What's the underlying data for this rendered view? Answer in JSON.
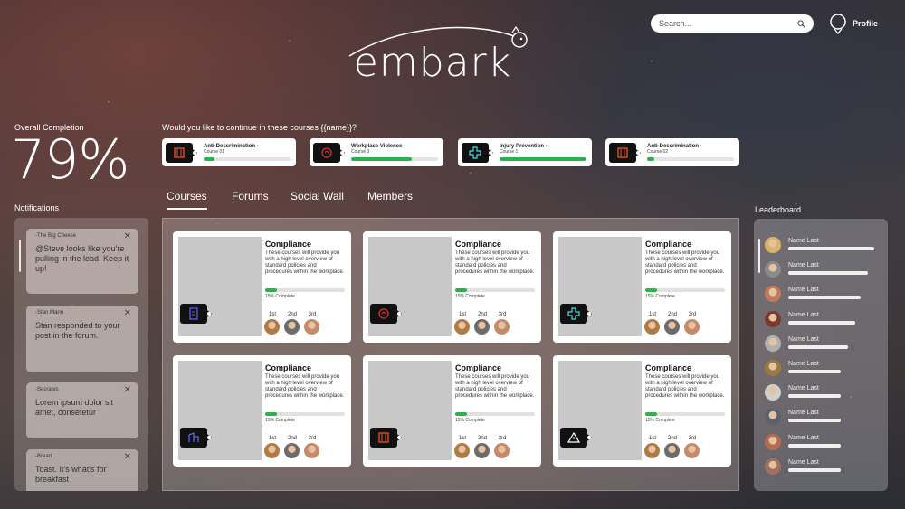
{
  "brand": {
    "name": "embark"
  },
  "search": {
    "placeholder": "Search..."
  },
  "profile": {
    "label": "Profile"
  },
  "overall": {
    "label": "Overall Completion",
    "value": "79%"
  },
  "continue": {
    "label": "Would you like to continue in these courses {{name}}?",
    "items": [
      {
        "title": "Anti-Descrimination -",
        "sub": "Course 01",
        "progress": 0.12,
        "icon": "shield-icon"
      },
      {
        "title": "Workplace Violence -",
        "sub": "Course 3",
        "progress": 0.7,
        "icon": "alarm-icon"
      },
      {
        "title": "Injury Prevention -",
        "sub": "Course 1",
        "progress": 1.0,
        "icon": "medical-cross-icon"
      },
      {
        "title": "Anti-Descrimination -",
        "sub": "Course 02",
        "progress": 0.08,
        "icon": "shield-icon"
      }
    ]
  },
  "notifications": {
    "label": "Notifications",
    "items": [
      {
        "author": "-The Big Cheese",
        "text": "@Steve looks like you're pulling in the lead. Keep it up!"
      },
      {
        "author": "-Stan Mann",
        "text": "Stan responded to your post in the forum."
      },
      {
        "author": "-Socrates",
        "text": "Lorem ipsum dolor sit amet, consetetur"
      },
      {
        "author": "-Bread",
        "text": "Toast. It's what's for breakfast"
      }
    ]
  },
  "tabs": [
    "Courses",
    "Forums",
    "Social Wall",
    "Members"
  ],
  "courses": [
    {
      "title": "Compliance",
      "desc": "These courses will provide you with a high level overview of standard policies and procedures within the workplace.",
      "pct_label": "15% Complete",
      "progress": 0.15,
      "icon": "document-icon",
      "accent": "#6a5cff"
    },
    {
      "title": "Compliance",
      "desc": "These courses will provide you with a high level overview of standard policies and procedures within the workplace.",
      "pct_label": "15% Complete",
      "progress": 0.15,
      "icon": "alarm-icon",
      "accent": "#e03030"
    },
    {
      "title": "Compliance",
      "desc": "These courses will provide you with a high level overview of standard policies and procedures within the workplace.",
      "pct_label": "15% Complete",
      "progress": 0.15,
      "icon": "medical-cross-icon",
      "accent": "#4fd6e0"
    },
    {
      "title": "Compliance",
      "desc": "These courses will provide you with a high level overview of standard policies and procedures within the workplace.",
      "pct_label": "15% Complete",
      "progress": 0.15,
      "icon": "building-icon",
      "accent": "#5a6cff"
    },
    {
      "title": "Compliance",
      "desc": "These courses will provide you with a high level overview of standard policies and procedures within the workplace.",
      "pct_label": "15% Complete",
      "progress": 0.15,
      "icon": "shield-icon",
      "accent": "#e8582a"
    },
    {
      "title": "Compliance",
      "desc": "These courses will provide you with a high level overview of standard policies and procedures within the workplace.",
      "pct_label": "15% Complete",
      "progress": 0.15,
      "icon": "warning-icon",
      "accent": "#ffffff"
    }
  ],
  "ranks": [
    "1st",
    "2nd",
    "3rd"
  ],
  "leaderboard": {
    "label": "Leaderboard",
    "items": [
      {
        "name": "Name Last",
        "score": 0.95
      },
      {
        "name": "Name Last",
        "score": 0.88
      },
      {
        "name": "Name Last",
        "score": 0.8
      },
      {
        "name": "Name Last",
        "score": 0.74
      },
      {
        "name": "Name Last",
        "score": 0.66
      },
      {
        "name": "Name Last",
        "score": 0.58
      },
      {
        "name": "Name Last",
        "score": 0.58
      },
      {
        "name": "Name Last",
        "score": 0.58
      },
      {
        "name": "Name Last",
        "score": 0.58
      },
      {
        "name": "Name Last",
        "score": 0.58
      }
    ]
  },
  "colors": {
    "progress": "#2bb24c",
    "card": "#ffffff",
    "badge": "#111111"
  }
}
